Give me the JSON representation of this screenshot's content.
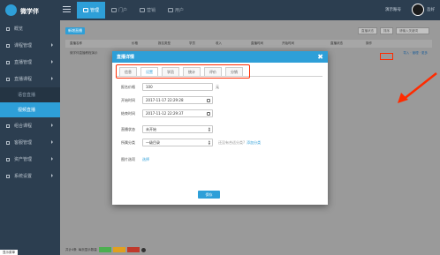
{
  "app": {
    "name": "微学伴"
  },
  "topnav": {
    "items": [
      {
        "label": "管理"
      },
      {
        "label": "门户"
      },
      {
        "label": "营销"
      },
      {
        "label": "用户"
      }
    ]
  },
  "user": {
    "info": "演示账号",
    "name": "吾好"
  },
  "sidebar": {
    "items": [
      {
        "label": "概览"
      },
      {
        "label": "课程管理"
      },
      {
        "label": "直播管理"
      },
      {
        "label": "直播课程"
      }
    ],
    "subitems": [
      {
        "label": "语音直播"
      },
      {
        "label": "视频直播"
      }
    ],
    "items2": [
      {
        "label": "组合课程"
      },
      {
        "label": "客服管理"
      },
      {
        "label": "资产管理"
      },
      {
        "label": "系统设置"
      }
    ],
    "bottom": "显示菜单"
  },
  "content": {
    "new_button": "新增直播",
    "filters": [
      "直播状态",
      "排序",
      "请输入关键词"
    ],
    "table": {
      "headers": [
        "直播名称",
        "价格",
        "报名类型",
        "学员",
        "收入",
        "直播时间",
        "开始时间",
        "直播状态",
        "操作"
      ],
      "row": {
        "name": "微学伴直播教程演示",
        "ops_highlight": "详情",
        "ops": "导入 · 管理 · 更多"
      }
    },
    "pager": {
      "label": "共计4条",
      "per_page": "每页显示数量"
    }
  },
  "modal": {
    "title": "直播详情",
    "tabs": [
      "信息",
      "设置",
      "学员",
      "统计",
      "评价",
      "分销"
    ],
    "active_tab": 1,
    "form": {
      "price": {
        "label": "报名价格",
        "value": "100",
        "unit": "元"
      },
      "start_time": {
        "label": "开始时间",
        "value": "2017-11-17 22:29:28"
      },
      "end_time": {
        "label": "结束时间",
        "value": "2017-11-12 22:29:37"
      },
      "status": {
        "label": "直播状态",
        "value": "未开始"
      },
      "category": {
        "label": "所属分类",
        "value": "一级目录",
        "hint": "还没有合适分类?",
        "link": "添加分类"
      },
      "cover": {
        "label": "图片选项",
        "link": "选择"
      }
    },
    "save_button": "保存"
  },
  "colors": {
    "accent": "#2e9fd8",
    "highlight": "#ff2b00"
  },
  "icons": [
    "logo-icon",
    "menu-icon",
    "close-icon",
    "calendar-icon",
    "arrow-icon"
  ]
}
